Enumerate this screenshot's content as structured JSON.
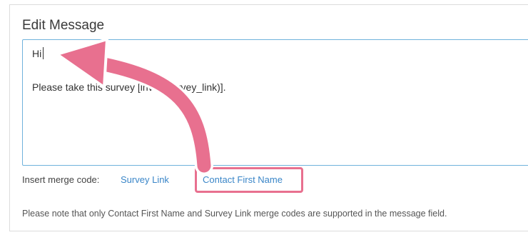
{
  "heading": "Edit Message",
  "editor": {
    "line_1": "Hi",
    "line_2": "Please take this survey [invite(survey_link)]."
  },
  "merge": {
    "label": "Insert merge code:",
    "links": [
      "Survey Link",
      "Contact First Name"
    ]
  },
  "note": "Please note that only Contact First Name and Survey Link merge codes are supported in the message field.",
  "colors": {
    "link": "#3a86c8",
    "annotation": "#e8708f",
    "editor_border": "#6fb2dc"
  },
  "annotation": {
    "arrow_icon": "curved-arrow-icon",
    "highlight_target": "Contact First Name"
  }
}
